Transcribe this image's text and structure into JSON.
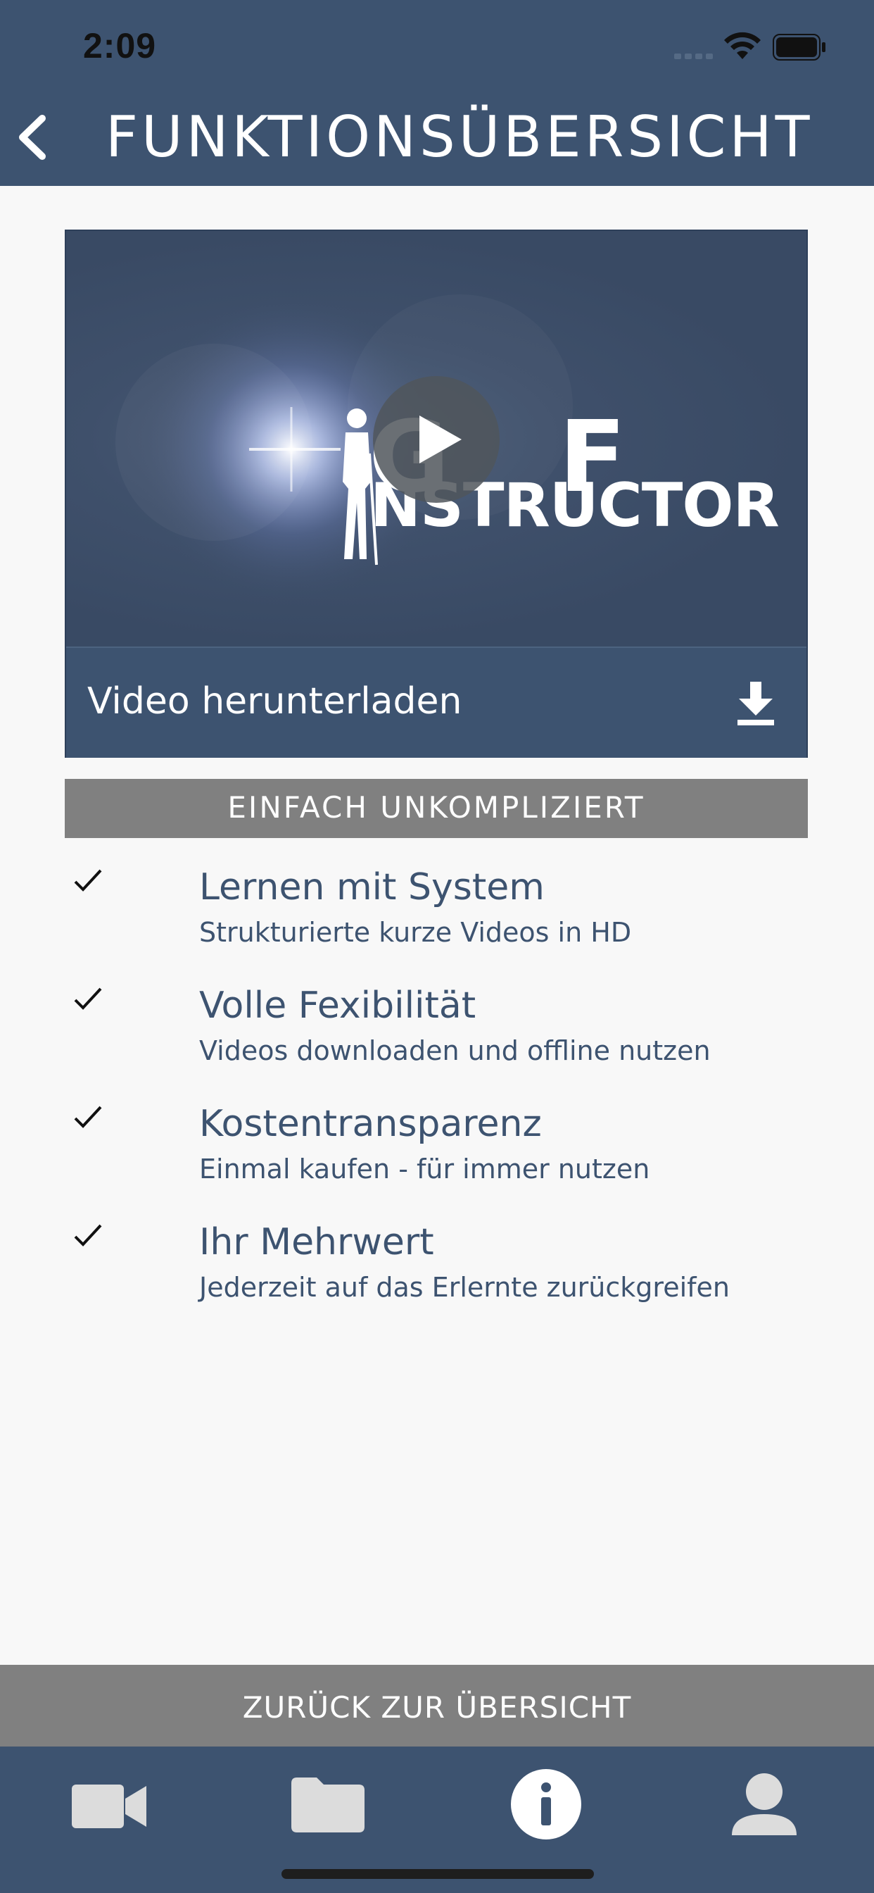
{
  "status_bar": {
    "time": "2:09"
  },
  "header": {
    "title": "FUNKTIONSÜBERSICHT"
  },
  "video": {
    "logo_line1_left": "G",
    "logo_line1_right": "F",
    "logo_line2": "NSTRUCTOR",
    "download_label": "Video herunterladen"
  },
  "section": {
    "title": "EINFACH UNKOMPLIZIERT"
  },
  "features": [
    {
      "title": "Lernen mit System",
      "subtitle": "Strukturierte kurze Videos in HD"
    },
    {
      "title": "Volle Fexibilität",
      "subtitle": "Videos downloaden und offline nutzen"
    },
    {
      "title": "Kostentransparenz",
      "subtitle": "Einmal kaufen - für immer nutzen"
    },
    {
      "title": "Ihr Mehrwert",
      "subtitle": "Jederzeit auf das Erlernte zurückgreifen"
    }
  ],
  "footer": {
    "back_label": "ZURÜCK ZUR ÜBERSICHT"
  },
  "tabbar": {
    "items": [
      {
        "icon": "video-camera-icon"
      },
      {
        "icon": "folder-icon"
      },
      {
        "icon": "info-icon",
        "active": true
      },
      {
        "icon": "person-icon"
      }
    ]
  },
  "colors": {
    "primary": "#3d5370",
    "bar_gray": "#808080",
    "background": "#f8f8f8"
  }
}
